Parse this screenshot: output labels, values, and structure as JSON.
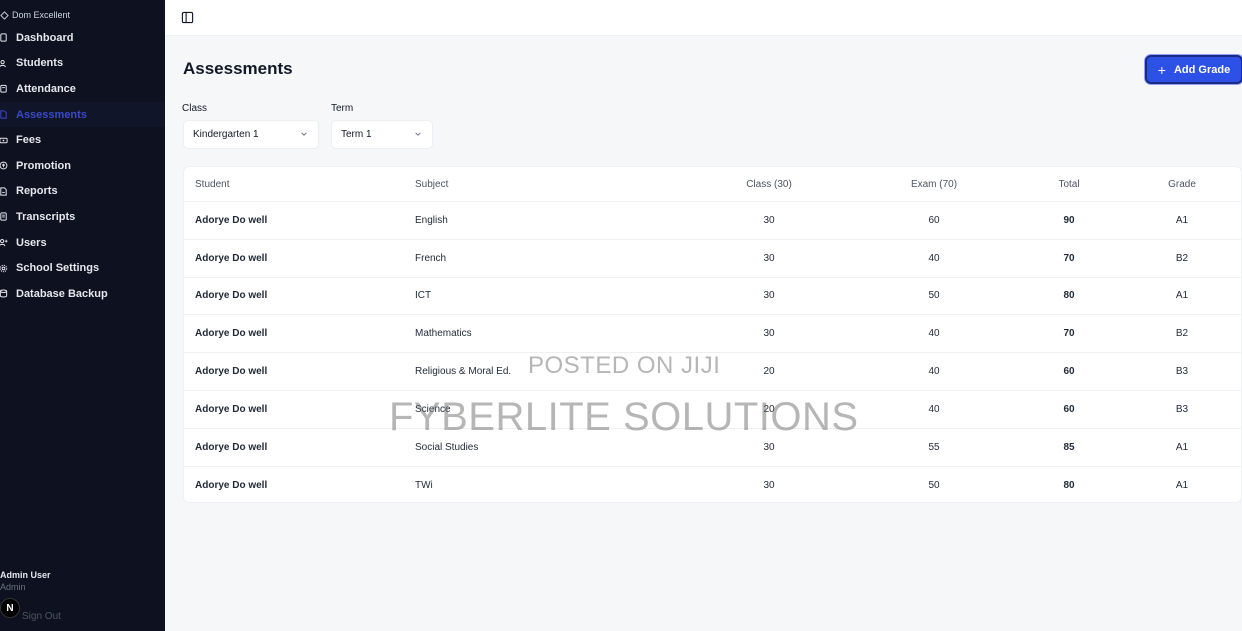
{
  "sidebar": {
    "brand": "Dom Excellent",
    "items": [
      {
        "label": "Dashboard",
        "icon": "dashboard-icon"
      },
      {
        "label": "Students",
        "icon": "users-icon"
      },
      {
        "label": "Attendance",
        "icon": "clipboard-icon"
      },
      {
        "label": "Assessments",
        "icon": "document-icon",
        "active": true
      },
      {
        "label": "Fees",
        "icon": "money-icon"
      },
      {
        "label": "Promotion",
        "icon": "promotion-icon"
      },
      {
        "label": "Reports",
        "icon": "report-icon"
      },
      {
        "label": "Transcripts",
        "icon": "transcript-icon"
      },
      {
        "label": "Users",
        "icon": "user-plus-icon"
      },
      {
        "label": "School Settings",
        "icon": "gear-icon"
      },
      {
        "label": "Database Backup",
        "icon": "database-icon"
      }
    ],
    "user": {
      "name": "Admin User",
      "role": "Admin"
    },
    "badge": "N",
    "sign_out": "Sign Out"
  },
  "main": {
    "title": "Assessments",
    "add_button": "Add Grade",
    "filters": {
      "class_label": "Class",
      "class_value": "Kindergarten 1",
      "term_label": "Term",
      "term_value": "Term 1"
    },
    "table": {
      "headers": {
        "student": "Student",
        "subject": "Subject",
        "class": "Class (30)",
        "exam": "Exam (70)",
        "total": "Total",
        "grade": "Grade"
      },
      "rows": [
        {
          "student": "Adorye Do well",
          "subject": "English",
          "class": "30",
          "exam": "60",
          "total": "90",
          "grade": "A1"
        },
        {
          "student": "Adorye Do well",
          "subject": "French",
          "class": "30",
          "exam": "40",
          "total": "70",
          "grade": "B2"
        },
        {
          "student": "Adorye Do well",
          "subject": "ICT",
          "class": "30",
          "exam": "50",
          "total": "80",
          "grade": "A1"
        },
        {
          "student": "Adorye Do well",
          "subject": "Mathematics",
          "class": "30",
          "exam": "40",
          "total": "70",
          "grade": "B2"
        },
        {
          "student": "Adorye Do well",
          "subject": "Religious & Moral Ed.",
          "class": "20",
          "exam": "40",
          "total": "60",
          "grade": "B3"
        },
        {
          "student": "Adorye Do well",
          "subject": "Science",
          "class": "20",
          "exam": "40",
          "total": "60",
          "grade": "B3"
        },
        {
          "student": "Adorye Do well",
          "subject": "Social Studies",
          "class": "30",
          "exam": "55",
          "total": "85",
          "grade": "A1"
        },
        {
          "student": "Adorye Do well",
          "subject": "TWi",
          "class": "30",
          "exam": "50",
          "total": "80",
          "grade": "A1"
        }
      ]
    }
  },
  "watermark": {
    "line1": "POSTED ON JIJI",
    "line2": "FYBERLITE SOLUTIONS"
  },
  "colors": {
    "sidebar_bg": "#0d1120",
    "accent": "#2d50e6",
    "active_nav": "#3b49c8",
    "page_bg": "#f6f7f9"
  }
}
